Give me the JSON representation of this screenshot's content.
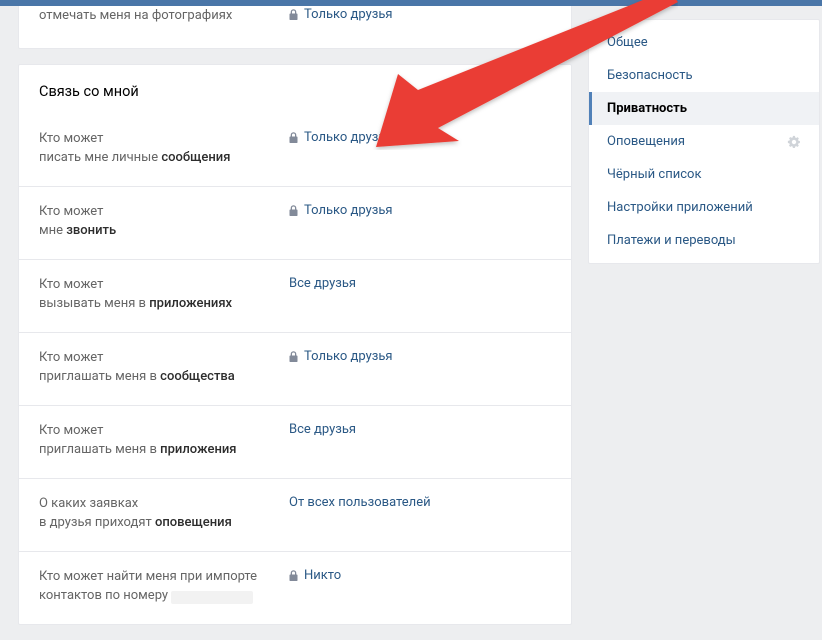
{
  "top_partial": {
    "label_line2": "отмечать меня на фотографиях",
    "value": "Только друзья",
    "has_lock": true
  },
  "section_title": "Связь со мной",
  "rows": [
    {
      "label_line1": "Кто может",
      "label_line2_pre": "писать мне личные ",
      "label_line2_bold": "сообщения",
      "label_line2_post": "",
      "value": "Только друзья",
      "has_lock": true
    },
    {
      "label_line1": "Кто может",
      "label_line2_pre": "мне ",
      "label_line2_bold": "звонить",
      "label_line2_post": "",
      "value": "Только друзья",
      "has_lock": true
    },
    {
      "label_line1": "Кто может",
      "label_line2_pre": "вызывать меня в ",
      "label_line2_bold": "приложениях",
      "label_line2_post": "",
      "value": "Все друзья",
      "has_lock": false
    },
    {
      "label_line1": "Кто может",
      "label_line2_pre": "приглашать меня в ",
      "label_line2_bold": "сообщества",
      "label_line2_post": "",
      "value": "Только друзья",
      "has_lock": true
    },
    {
      "label_line1": "Кто может",
      "label_line2_pre": "приглашать меня в ",
      "label_line2_bold": "приложения",
      "label_line2_post": "",
      "value": "Все друзья",
      "has_lock": false
    },
    {
      "label_line1": "О каких заявках",
      "label_line2_pre": "в друзья приходят ",
      "label_line2_bold": "оповещения",
      "label_line2_post": "",
      "value": "От всех пользователей",
      "has_lock": false
    },
    {
      "label_line1": "Кто может найти меня при импорте",
      "label_line2_pre": "контактов по номеру ",
      "label_line2_bold": "",
      "label_line2_post": "",
      "value": "Никто",
      "has_lock": true,
      "redacted": true
    }
  ],
  "nav": {
    "items": [
      {
        "label": "Общее"
      },
      {
        "label": "Безопасность"
      },
      {
        "label": "Приватность",
        "active": true
      },
      {
        "label": "Оповещения",
        "gear": true
      },
      {
        "label": "Чёрный список"
      },
      {
        "label": "Настройки приложений"
      },
      {
        "label": "Платежи и переводы"
      }
    ]
  }
}
